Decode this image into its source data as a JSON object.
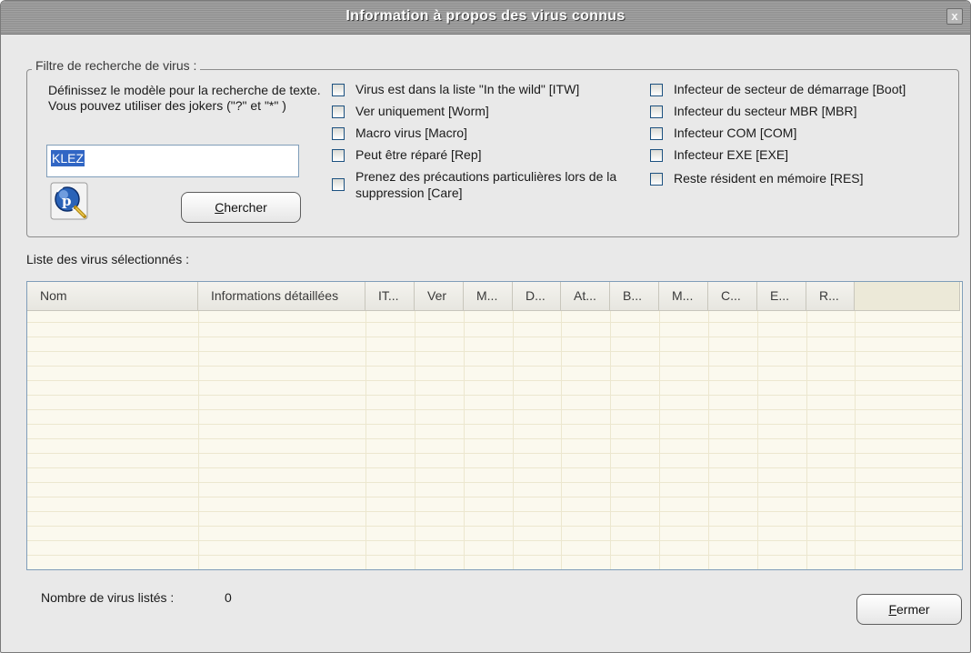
{
  "window": {
    "title": "Information à propos des virus connus",
    "close_glyph": "x"
  },
  "filter": {
    "legend": "Filtre de recherche de virus :",
    "description": "Définissez le modèle pour la recherche de texte. Vous pouvez utiliser des jokers (\"?\" et \"*\" )",
    "input_value": "KLEZ",
    "search_button": {
      "underlined": "C",
      "rest": "hercher"
    },
    "checkboxes_left": [
      {
        "label": "Virus est dans la liste \"In the wild\" [ITW]",
        "checked": false
      },
      {
        "label": "Ver uniquement [Worm]",
        "checked": false
      },
      {
        "label": "Macro virus [Macro]",
        "checked": false
      },
      {
        "label": "Peut être réparé [Rep]",
        "checked": false
      },
      {
        "label": "Prenez des précautions particulières lors de la suppression [Care]",
        "checked": false
      }
    ],
    "checkboxes_right": [
      {
        "label": "Infecteur de secteur de démarrage [Boot]",
        "checked": false
      },
      {
        "label": "Infecteur du secteur MBR [MBR]",
        "checked": false
      },
      {
        "label": "Infecteur COM [COM]",
        "checked": false
      },
      {
        "label": "Infecteur EXE [EXE]",
        "checked": false
      },
      {
        "label": "Reste résident en mémoire [RES]",
        "checked": false
      }
    ]
  },
  "list": {
    "label": "Liste des virus sélectionnés :",
    "columns": [
      "Nom",
      "Informations détaillées",
      "IT...",
      "Ver",
      "M...",
      "D...",
      "At...",
      "B...",
      "M...",
      "C...",
      "E...",
      "R..."
    ],
    "rows": []
  },
  "footer": {
    "count_label": "Nombre de virus listés :",
    "count_value": "0",
    "close_button": {
      "underlined": "F",
      "rest": "ermer"
    }
  },
  "colors": {
    "title_bar": "#8f8f8f",
    "list_background": "#fbf9ee",
    "selection": "#3166c4"
  }
}
